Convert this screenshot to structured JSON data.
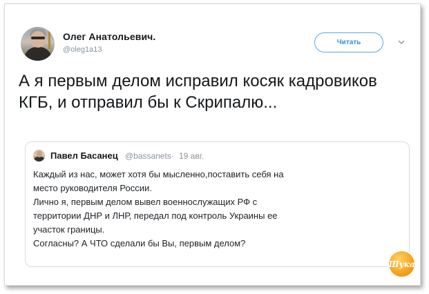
{
  "tweet": {
    "author_name": "Олег Анатольевич.",
    "author_handle": "@oleg1a13",
    "follow_label": "Читать",
    "text": "А я первым делом исправил косяк кадровиков КГБ, и отправил бы к Скрипалю..."
  },
  "quoted_tweet": {
    "author_name": "Павел Басанец",
    "author_handle": "@bassanets",
    "separator": "·",
    "date": "19 авг.",
    "lines": [
      "Каждый из нас, может хотя бы мысленно,поставить себя на",
      "место руководителя России.",
      "Лично я, первым делом вывел военнослужащих РФ с",
      "территории ДНР и ЛНР, передал под контроль Украины ее",
      "участок границы.",
      "Согласны? А ЧТО сделали бы Вы, первым делом?"
    ]
  },
  "watermark": {
    "text": "Шука"
  },
  "icons": {
    "more": "chevron-down-icon"
  },
  "colors": {
    "accent": "#3a8fd6",
    "secondary_text": "#8a939b",
    "watermark": "#f7a21b"
  }
}
